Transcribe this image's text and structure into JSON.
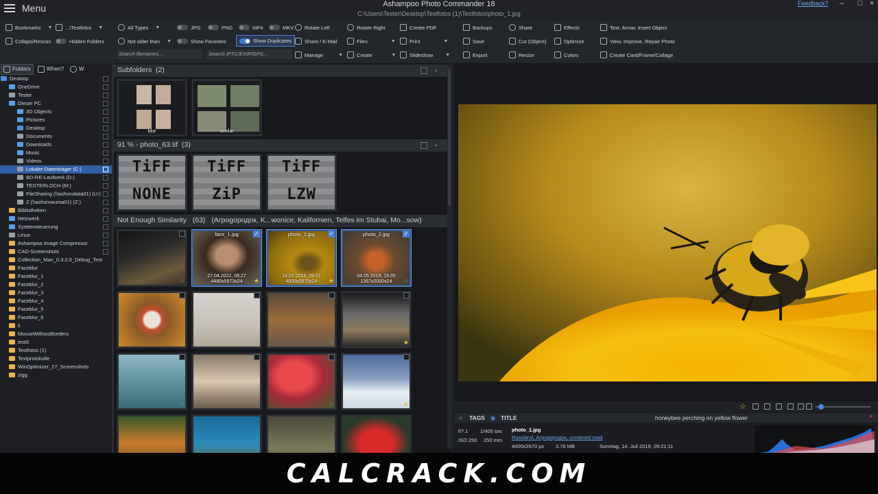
{
  "window": {
    "title": "Ashampoo Photo Commander 18",
    "path": "C:\\Users\\Tester\\Desktop\\Testfotos (1)\\Testfotos\\photo_1.jpg",
    "menu_label": "Menu",
    "feedback_label": "Feedback?",
    "controls": [
      "–",
      "□",
      "×"
    ]
  },
  "toolbar": {
    "bookmarks": "Bookmarks",
    "testfotos_dd": "...\\Testfotos",
    "collapse_rescan": "Collaps/Rescan",
    "hidden_folders": "Hidden Folders",
    "all_types": "All Types",
    "jpg": "JPG",
    "png": "PNG",
    "mp4": "MP4",
    "mkv": "MKV",
    "not_older_than": "Not older than",
    "show_favorites": "Show Favorites",
    "show_duplicates": "Show Duplicates",
    "search_filenames_placeholder": "Search filenames...",
    "search_iptc_placeholder": "Search IPTC/EXIF/GPS...",
    "rotate_left": "Rotate Left",
    "rotate_right": "Rotate Right",
    "create_pdf": "Create PDF",
    "share_email": "Share / E-Mail",
    "files": "Files",
    "print": "Print",
    "manage": "Manage",
    "create": "Create",
    "slideshow": "Slideshow",
    "backups": "Backups",
    "share": "Share",
    "effects": "Effects",
    "save": "Save",
    "cut_object": "Cut (Object)",
    "optimize": "Optimize",
    "export": "Export",
    "resize": "Resize",
    "colors": "Colors",
    "text_arrow": "Text, Arrow, Insert Object",
    "view_improve": "View, Improve, Repair Photo",
    "create_card": "Create Card/Frame/Collage"
  },
  "left_panel": {
    "tab_folders": "Folders",
    "tab_when": "When?",
    "tab_where": "W",
    "tree": [
      {
        "label": "Desktop",
        "indent": 0,
        "icon": "blue"
      },
      {
        "label": "OneDrive",
        "indent": 1,
        "icon": "sys"
      },
      {
        "label": "Tester",
        "indent": 1,
        "icon": "grey"
      },
      {
        "label": "Dieser PC",
        "indent": 1,
        "icon": "sys"
      },
      {
        "label": "3D Objects",
        "indent": 2,
        "icon": "sys"
      },
      {
        "label": "Pictures",
        "indent": 2,
        "icon": "sys"
      },
      {
        "label": "Desktop",
        "indent": 2,
        "icon": "blue"
      },
      {
        "label": "Documents",
        "indent": 2,
        "icon": "grey"
      },
      {
        "label": "Downloads",
        "indent": 2,
        "icon": "sys"
      },
      {
        "label": "Music",
        "indent": 2,
        "icon": "sys"
      },
      {
        "label": "Videos",
        "indent": 2,
        "icon": "grey"
      },
      {
        "label": "Lokaler Datenträger (C:)",
        "indent": 2,
        "icon": "grey",
        "selected": true
      },
      {
        "label": "BD-RE-Laufwerk (D:)",
        "indent": 2,
        "icon": "grey"
      },
      {
        "label": "TESTERLOCH (M:)",
        "indent": 2,
        "icon": "grey"
      },
      {
        "label": "FileSharing (\\\\ashsrvdata01) (U:)",
        "indent": 2,
        "icon": "grey"
      },
      {
        "label": "Z (\\\\ashsrvwuma01) (Z:)",
        "indent": 2,
        "icon": "grey"
      },
      {
        "label": "Bibliotheken",
        "indent": 1,
        "icon": "folder"
      },
      {
        "label": "Netzwerk",
        "indent": 1,
        "icon": "sys"
      },
      {
        "label": "Systemsteuerung",
        "indent": 1,
        "icon": "sys"
      },
      {
        "label": "Linux",
        "indent": 1,
        "icon": "grey"
      },
      {
        "label": "Ashampoo Image Compressor",
        "indent": 1,
        "icon": "folder"
      },
      {
        "label": "CAD-Screenshots",
        "indent": 1,
        "icon": "folder"
      },
      {
        "label": "Collection_Man_0.3.2.0_Debug_Test",
        "indent": 1,
        "icon": "folder"
      },
      {
        "label": "Faceblur",
        "indent": 1,
        "icon": "folder"
      },
      {
        "label": "Faceblur_1",
        "indent": 1,
        "icon": "folder"
      },
      {
        "label": "Faceblur_2",
        "indent": 1,
        "icon": "folder"
      },
      {
        "label": "Faceblur_3",
        "indent": 1,
        "icon": "folder"
      },
      {
        "label": "Faceblur_4",
        "indent": 1,
        "icon": "folder"
      },
      {
        "label": "Faceblur_5",
        "indent": 1,
        "icon": "folder"
      },
      {
        "label": "Faceblur_6",
        "indent": 1,
        "icon": "folder"
      },
      {
        "label": "ii",
        "indent": 1,
        "icon": "folder"
      },
      {
        "label": "MouseWithoutBorders",
        "indent": 1,
        "icon": "folder"
      },
      {
        "label": "test0",
        "indent": 1,
        "icon": "folder"
      },
      {
        "label": "Testfotos (1)",
        "indent": 1,
        "icon": "folder"
      },
      {
        "label": "Textprotokolle",
        "indent": 1,
        "icon": "folder"
      },
      {
        "label": "WinOptimizer_27_Screenshots",
        "indent": 1,
        "icon": "folder"
      },
      {
        "label": "zigg",
        "indent": 1,
        "icon": "folder"
      }
    ]
  },
  "browser": {
    "groups": [
      {
        "title": "Subfolders",
        "count": "(2)"
      },
      {
        "title": "91 % - photo_63.tif",
        "count": "(3)"
      },
      {
        "title": "Not Enough Similarity",
        "count": "(63)",
        "extra": "(Агроgородок, K...wonice, Kalifornien, Telfes im Stubai, Mo...sow)"
      }
    ],
    "subfolders": [
      "blur",
      "similar"
    ],
    "tiff": [
      "TIFF NONE",
      "TIFF ZIP",
      "TIFF LZW"
    ],
    "tiff_words": [
      [
        "TiFF",
        "NONE"
      ],
      [
        "TiFF",
        "ZiP"
      ],
      [
        "TiFF",
        "LZW"
      ]
    ],
    "selected_thumbs": [
      {
        "name": "face_1.jpg",
        "date": "27.04.2022, 08:27",
        "dims": "4480x5973x24"
      },
      {
        "name": "photo_1.jpg",
        "date": "14.07.2019, 09:21",
        "dims": "4000x2670x24"
      },
      {
        "name": "photo_2.jpg",
        "date": "04.05.2019, 19:35",
        "dims": "1367x2000x24"
      }
    ]
  },
  "info": {
    "tags_label": "TAGS",
    "title_label": "TITLE",
    "title_value": "honeybee perching on yellow flower",
    "aperture": "f/7.1",
    "shutter": "1/400 sec",
    "iso": "ISO 250",
    "focal": "250 mm",
    "filename": "photo_1.jpg",
    "location": "Russland, Агроgородок, unnamed road",
    "dims": "4000x2670 px",
    "size": "3.78 MB",
    "date": "Sonntag, 14. Juli 2019, 09:21:11"
  },
  "watermark": "CALCRACK.COM",
  "colors": {
    "accent": "#4a82d8",
    "selection": "#2f5fa8",
    "star": "#e8c14a"
  }
}
